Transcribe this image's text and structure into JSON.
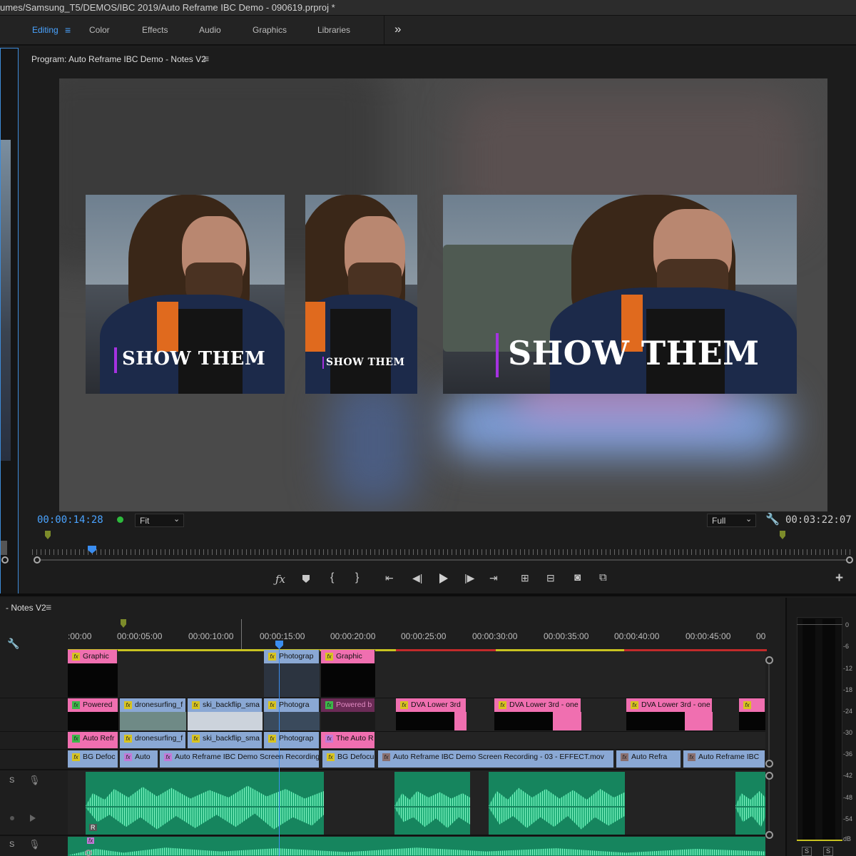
{
  "window": {
    "title": "umes/Samsung_T5/DEMOS/IBC 2019/Auto Reframe IBC Demo - 090619.prproj *"
  },
  "workspaces": {
    "items": [
      "Editing",
      "Color",
      "Effects",
      "Audio",
      "Graphics",
      "Libraries"
    ],
    "active": "Editing",
    "overflow_icon": "double-chevron-right-icon"
  },
  "program_monitor": {
    "title": "Program: Auto Reframe IBC Demo - Notes V2",
    "timecode_current": "00:00:14:28",
    "timecode_duration": "00:03:22:07",
    "fit_select": "Fit",
    "resolution_select": "Full",
    "preview": {
      "frame_titles": [
        "SHOW THEM",
        "SHOW THEM",
        "SHOW THEM"
      ]
    }
  },
  "timeline": {
    "sequence_name": "- Notes V2",
    "ruler_ticks": [
      ":00:00",
      "00:00:05:00",
      "00:00:10:00",
      "00:00:15:00",
      "00:00:20:00",
      "00:00:25:00",
      "00:00:30:00",
      "00:00:35:00",
      "00:00:40:00",
      "00:00:45:00",
      "00"
    ],
    "track_v4": [
      "Graphic",
      "Photograp",
      "Graphic"
    ],
    "track_v3": [
      "Powered",
      "dronesurfing_f",
      "ski_backflip_sma",
      "Photogra",
      "Powered b",
      "DVA Lower 3rd",
      "DVA Lower 3rd - one",
      "DVA Lower 3rd - one"
    ],
    "track_v2": [
      "Auto Refr",
      "dronesurfing_f",
      "ski_backflip_sma",
      "Photograp",
      "The Auto R"
    ],
    "track_v1": [
      "BG Defoc",
      "Auto",
      "Auto Reframe IBC Demo Screen Recording - 0",
      "BG Defocu",
      "Auto Reframe IBC Demo Screen Recording - 03 - EFFECT.mov",
      "Auto Refra",
      "Auto Reframe IBC"
    ],
    "audio_track_labels": {
      "solo": "S",
      "audio_clip_marker": "R"
    }
  },
  "audio_meter": {
    "scale": [
      "0",
      "-6",
      "-12",
      "-18",
      "-24",
      "-30",
      "-36",
      "-42",
      "-48",
      "-54",
      "dB"
    ],
    "solo_left": "S",
    "solo_right": "S"
  }
}
